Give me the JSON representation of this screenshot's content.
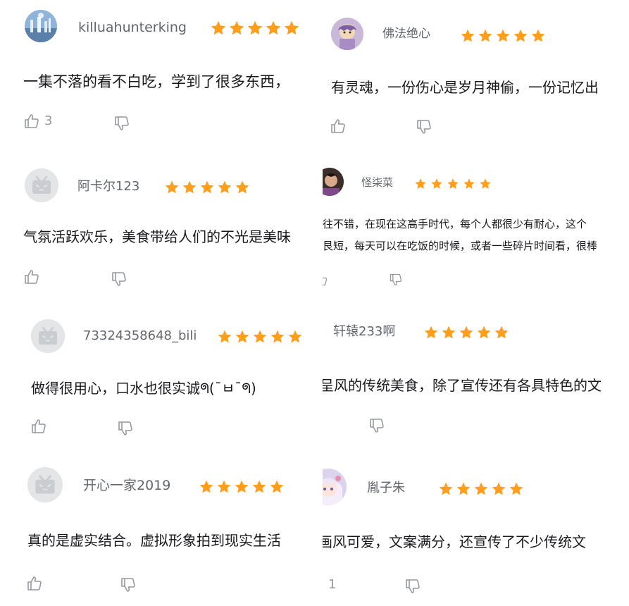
{
  "colors": {
    "star": "#ff9e1b",
    "username": "#61666d",
    "text": "#18191c",
    "icon": "#9499a0",
    "default_avatar_bg": "#e3e5e7"
  },
  "icons": {
    "star": "star-icon",
    "like": "thumbs-up-icon",
    "dislike": "thumbs-down-icon",
    "default_avatar": "bilibili-tv-icon"
  },
  "reviews": [
    {
      "username": "killuahunterking",
      "rating": 5,
      "text": "一集不落的看不白吃，学到了很多东西，",
      "likes": "3",
      "avatar": "photo"
    },
    {
      "username": "佛法绝心",
      "rating": 5,
      "text": "有灵魂，一份伤心是岁月神偷，一份记忆出",
      "likes": "",
      "avatar": "illustration"
    },
    {
      "username": "阿卡尔123",
      "rating": 5,
      "text": "气氛活跃欢乐，美食带给人们的不光是美味",
      "likes": "",
      "avatar": "default"
    },
    {
      "username": "怪柒菜",
      "rating": 5,
      "text_lines": [
        "往不错，在现在这高手时代，每个人都很少有耐心，这个",
        "艮短，每天可以在吃饭的时候，或者一些碎片时间看，很棒"
      ],
      "likes": "",
      "avatar": "photo"
    },
    {
      "username": "73324358648_bili",
      "rating": 5,
      "text": "做得很用心，口水也很实诚ᖗ(¯ㅂ¯ᖗ)",
      "likes": "",
      "avatar": "default"
    },
    {
      "username": "轩辕233啊",
      "rating": 5,
      "text": "呈风的传统美食，除了宣传还有各具特色的文",
      "likes": "",
      "avatar": "none"
    },
    {
      "username": "开心一家2019",
      "rating": 5,
      "text": "真的是虚实结合。虚拟形象拍到现实生活",
      "likes": "",
      "avatar": "default"
    },
    {
      "username": "胤子朱",
      "rating": 5,
      "text": "画风可爱，文案满分，还宣传了不少传统文",
      "likes": "1",
      "avatar": "anime"
    }
  ]
}
